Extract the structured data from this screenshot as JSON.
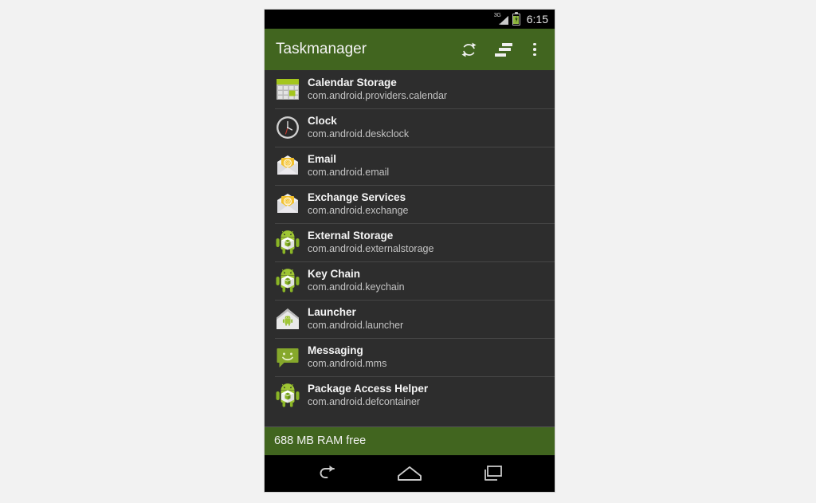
{
  "status_bar": {
    "network_label": "3G",
    "time": "6:15",
    "icons": [
      "signal-icon",
      "battery-icon"
    ]
  },
  "app_bar": {
    "title": "Taskmanager",
    "actions": [
      {
        "name": "refresh-button",
        "icon": "refresh-icon"
      },
      {
        "name": "sort-button",
        "icon": "sort-icon"
      },
      {
        "name": "overflow-menu-button",
        "icon": "more-vertical-icon"
      }
    ]
  },
  "list": {
    "items": [
      {
        "title": "Calendar Storage",
        "package": "com.android.providers.calendar",
        "icon": "calendar-icon"
      },
      {
        "title": "Clock",
        "package": "com.android.deskclock",
        "icon": "clock-icon"
      },
      {
        "title": "Email",
        "package": "com.android.email",
        "icon": "email-icon"
      },
      {
        "title": "Exchange Services",
        "package": "com.android.exchange",
        "icon": "email-icon"
      },
      {
        "title": "External Storage",
        "package": "com.android.externalstorage",
        "icon": "android-package-icon"
      },
      {
        "title": "Key Chain",
        "package": "com.android.keychain",
        "icon": "android-package-icon"
      },
      {
        "title": "Launcher",
        "package": "com.android.launcher",
        "icon": "home-android-icon"
      },
      {
        "title": "Messaging",
        "package": "com.android.mms",
        "icon": "message-bubble-icon"
      },
      {
        "title": "Package Access Helper",
        "package": "com.android.defcontainer",
        "icon": "android-package-icon"
      }
    ]
  },
  "footer": {
    "ram_text": "688 MB RAM free"
  },
  "nav_bar": {
    "buttons": [
      {
        "name": "back-button",
        "icon": "back-arrow-icon"
      },
      {
        "name": "home-button",
        "icon": "home-icon"
      },
      {
        "name": "recents-button",
        "icon": "recents-icon"
      }
    ]
  },
  "colors": {
    "accent_green": "#41651f",
    "list_background": "#2d2d2d",
    "divider": "#464646",
    "page_background": "#f2f2f2",
    "status_bar": "#000000"
  }
}
